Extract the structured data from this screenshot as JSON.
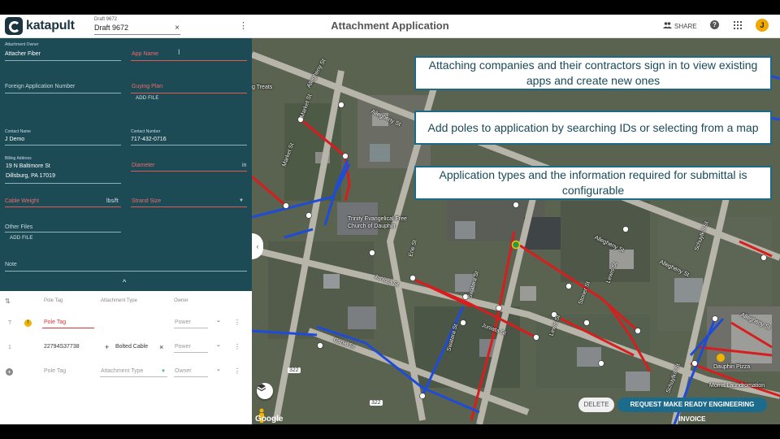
{
  "header": {
    "logo_text": "katapult",
    "draft_label": "Draft 9672",
    "draft_value": "Draft 9672",
    "clear_icon": "×",
    "menu_icon": "⋮",
    "title": "Attachment Application",
    "share_label": "SHARE",
    "help_icon": "?",
    "avatar_initial": "J"
  },
  "form": {
    "attachment_owner": {
      "label": "Attachment Owner",
      "value": "Attacher Fiber"
    },
    "app_name": {
      "placeholder": "App Name"
    },
    "foreign_app_number": {
      "placeholder": "Foreign Application Number"
    },
    "guying_plan": {
      "placeholder": "Guying Plan",
      "add_file": "ADD FILE"
    },
    "contact_name": {
      "label": "Contact Name",
      "value": "J Demo"
    },
    "contact_number": {
      "label": "Contact Number",
      "value": "717-432-0716"
    },
    "billing_address": {
      "label": "Billing Address",
      "line1": "19 N Baltimore St",
      "line2": "Dillsburg, PA 17019"
    },
    "diameter": {
      "placeholder": "Diameter",
      "unit": "in"
    },
    "cable_weight": {
      "placeholder": "Cable Weight",
      "unit": "lbs/ft"
    },
    "strand_size": {
      "placeholder": "Strand Size"
    },
    "other_files": {
      "placeholder": "Other Files",
      "add_file": "ADD FILE"
    },
    "note": {
      "placeholder": "Note"
    },
    "collapse_icon": "^"
  },
  "table": {
    "headers": {
      "sort": "⇅",
      "pole_tag": "Pole Tag",
      "attachment_type": "Attachment Type",
      "owner": "Owner"
    },
    "rows": [
      {
        "index": "T",
        "warning": "!",
        "pole_tag": "Pole Tag",
        "attachment_type": "",
        "owner": "Power"
      },
      {
        "index": "1",
        "pole_tag": "22794S37738",
        "add_icon": "+",
        "attachment_type": "Bolted Cable",
        "remove_icon": "×",
        "owner": "Power"
      },
      {
        "add_icon": "+",
        "pole_tag": "Pole Tag",
        "attachment_type": "Attachment Type",
        "owner": "Owner"
      }
    ],
    "row_menu_icon": "⋮",
    "chevron_icon": "⌄"
  },
  "map": {
    "callouts": [
      "Attaching companies and their contractors sign in to view existing apps and create new ones",
      "Add poles to application by searching IDs or selecting from a map",
      "Application types and the information required for submittal is configurable"
    ],
    "collapse_icon": "‹",
    "google_label": "Google",
    "delete_label": "DELETE",
    "request_label": "REQUEST MAKE READY ENGINEERING INVOICE",
    "labels": {
      "church": "Trinity Evangelical Free Church of Dauphin",
      "pizza": "Dauphin Pizza",
      "laundromat": "Morris Laundromation",
      "treats": "g Treats",
      "allegheny": "Allegheny St",
      "market": "Market St",
      "juniata": "Juniata St",
      "canal": "Canal St",
      "erie": "Erie St",
      "schuylkill": "Schuylkill St",
      "lewis": "Lewis St",
      "stoner": "Stoner St",
      "swatara": "Swatara St",
      "route": "322"
    }
  }
}
